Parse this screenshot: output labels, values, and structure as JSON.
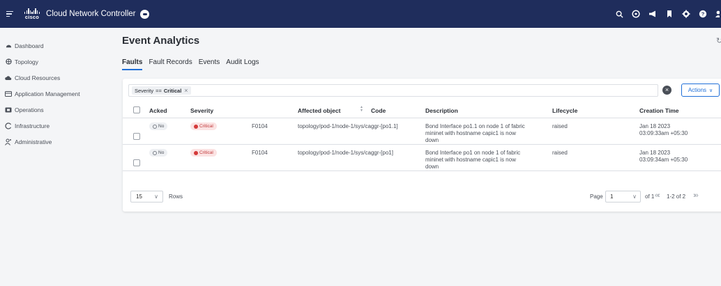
{
  "header": {
    "logo_text": "cisco",
    "app_title": "Cloud Network Controller",
    "icons": [
      "search-icon",
      "assistant-icon",
      "megaphone-icon",
      "bookmark-icon",
      "settings-icon",
      "help-icon",
      "user-icon"
    ]
  },
  "sidebar": {
    "items": [
      {
        "label": "Dashboard",
        "icon": "dashboard-icon"
      },
      {
        "label": "Topology",
        "icon": "topology-icon"
      },
      {
        "label": "Cloud Resources",
        "icon": "cloud-icon"
      },
      {
        "label": "Application Management",
        "icon": "application-icon"
      },
      {
        "label": "Operations",
        "icon": "operations-icon"
      },
      {
        "label": "Infrastructure",
        "icon": "infrastructure-icon"
      },
      {
        "label": "Administrative",
        "icon": "admin-icon"
      }
    ]
  },
  "page": {
    "title": "Event Analytics",
    "tabs": [
      {
        "label": "Faults",
        "active": true
      },
      {
        "label": "Fault Records",
        "active": false
      },
      {
        "label": "Events",
        "active": false
      },
      {
        "label": "Audit Logs",
        "active": false
      }
    ]
  },
  "filter": {
    "field": "Severity",
    "operator": "==",
    "value": "Critical",
    "actions_label": "Actions"
  },
  "table": {
    "columns": [
      "Acked",
      "Severity",
      "Code",
      "Affected object",
      "Description",
      "Lifecycle",
      "Creation Time"
    ],
    "rows": [
      {
        "acked": "No",
        "severity": "Critical",
        "code": "F0104",
        "affected_object": "topology/pod-1/node-1/sys/caggr-[po1.1]",
        "description": [
          "Bond Interface po1.1 on node 1 of fabric",
          "mininet with hostname capic1 is now",
          "down"
        ],
        "lifecycle": "raised",
        "creation_time": [
          "Jan 18 2023",
          "03:09:33am +05:30"
        ]
      },
      {
        "acked": "No",
        "severity": "Critical",
        "code": "F0104",
        "affected_object": "topology/pod-1/node-1/sys/caggr-[po1]",
        "description": [
          "Bond Interface po1 on node 1 of fabric",
          "mininet with hostname capic1 is now",
          "down"
        ],
        "lifecycle": "raised",
        "creation_time": [
          "Jan 18 2023",
          "03:09:34am +05:30"
        ]
      }
    ]
  },
  "pagination": {
    "rows_per_page": "15",
    "rows_label": "Rows",
    "page_label": "Page",
    "page_value": "1",
    "of_label": "of 1",
    "range_label": "1-2 of 2"
  },
  "colors": {
    "header_bg": "#1f2d5c",
    "accent": "#1f6fd8",
    "critical": "#d43a3a"
  }
}
